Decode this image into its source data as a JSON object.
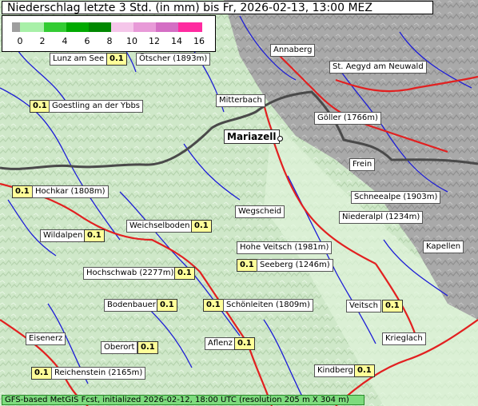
{
  "title": "Niederschlag letzte 3 Std. (in mm) bis Fr, 2026-02-13, 13:00 MEZ",
  "legend": {
    "ticks": [
      "0",
      "2",
      "4",
      "6",
      "8",
      "10",
      "12",
      "14",
      "16"
    ],
    "colors": [
      "#9e9e9e",
      "#a8f0a8",
      "#33cc33",
      "#00aa00",
      "#008800",
      "#f5c6ea",
      "#e89ad8",
      "#d46ec4",
      "#ff2aa0"
    ]
  },
  "places": [
    {
      "id": "lunz",
      "label": "Lunz am See",
      "value": "0.1"
    },
    {
      "id": "oetscher",
      "label": "Ötscher (1893m)"
    },
    {
      "id": "annaberg",
      "label": "Annaberg"
    },
    {
      "id": "st-aegyd",
      "label": "St. Aegyd am Neuwald"
    },
    {
      "id": "goestling",
      "label": "Goestling an der Ybbs",
      "value": "0.1"
    },
    {
      "id": "mitterbach",
      "label": "Mitterbach"
    },
    {
      "id": "goeller",
      "label": "Göller (1766m)"
    },
    {
      "id": "mariazell",
      "label": "Mariazell"
    },
    {
      "id": "frein",
      "label": "Frein"
    },
    {
      "id": "hochkar",
      "label": "Hochkar (1808m)",
      "value": "0.1"
    },
    {
      "id": "schneealpe",
      "label": "Schneealpe (1903m)"
    },
    {
      "id": "wegscheid",
      "label": "Wegscheid"
    },
    {
      "id": "niederalpl",
      "label": "Niederalpl (1234m)"
    },
    {
      "id": "weichselboden",
      "label": "Weichselboden",
      "value": "0.1"
    },
    {
      "id": "wildalpen",
      "label": "Wildalpen",
      "value": "0.1"
    },
    {
      "id": "hohe-veitsch",
      "label": "Hohe Veitsch (1981m)"
    },
    {
      "id": "kapellen",
      "label": "Kapellen"
    },
    {
      "id": "seeberg",
      "label": "Seeberg (1246m)",
      "value": "0.1"
    },
    {
      "id": "hochschwab",
      "label": "Hochschwab (2277m)",
      "value": "0.1"
    },
    {
      "id": "bodenbauer",
      "label": "Bodenbauer",
      "value": "0.1"
    },
    {
      "id": "schoenleiten",
      "label": "Schönleiten (1809m)",
      "value": "0.1"
    },
    {
      "id": "veitsch",
      "label": "Veitsch",
      "value": "0.1"
    },
    {
      "id": "eisenerz",
      "label": "Eisenerz"
    },
    {
      "id": "kriegla",
      "label": "Krieglach"
    },
    {
      "id": "oberort",
      "label": "Oberort",
      "value": "0.1"
    },
    {
      "id": "aflenz",
      "label": "Aflenz",
      "value": "0.1"
    },
    {
      "id": "reichenstein",
      "label": "Reichenstein (2165m)",
      "value": "0.1"
    },
    {
      "id": "kindberg",
      "label": "Kindberg",
      "value": "0.1"
    }
  ],
  "footer": "GFS-based MetGIS Fcst, initialized 2026-02-12, 18:00 UTC  (resolution 205 m X 304 m)"
}
